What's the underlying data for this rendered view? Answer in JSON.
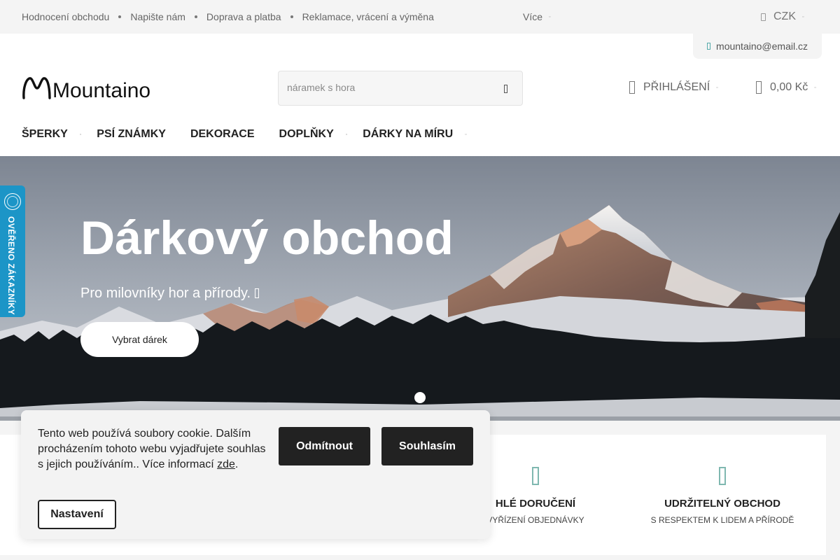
{
  "topbar": {
    "links": [
      "Hodnocení obchodu",
      "Napište nám",
      "Doprava a platba",
      "Reklamace, vrácení a výměna"
    ],
    "more_label": "Více",
    "currency": "CZK"
  },
  "contact": {
    "email": "mountaino@email.cz"
  },
  "header": {
    "logo_text": "Mountaino",
    "search_placeholder": "náramek s hora",
    "login_label": "PŘIHLÁŠENÍ",
    "cart_total": "0,00 Kč"
  },
  "menu": {
    "items": [
      {
        "label": "ŠPERKY",
        "has_submenu": true
      },
      {
        "label": "PSÍ ZNÁMKY",
        "has_submenu": false
      },
      {
        "label": "DEKORACE",
        "has_submenu": false
      },
      {
        "label": "DOPLŇKY",
        "has_submenu": true
      },
      {
        "label": "DÁRKY NA MÍRU",
        "has_submenu": true
      }
    ]
  },
  "hero": {
    "title": "Dárkový obchod",
    "subtitle": "Pro milovníky hor a přírody. ",
    "button": "Vybrat dárek",
    "slides": 1
  },
  "badge": {
    "text": "OVĚŘENO ZÁKAZNÍKY",
    "color": "#1c95c7"
  },
  "benefits": [
    {
      "title": "HLÉ DORUČENÍ",
      "subtitle": "VYŘÍZENÍ OBJEDNÁVKY"
    },
    {
      "title": "UDRŽITELNÝ OBCHOD",
      "subtitle": "S RESPEKTEM K LIDEM A PŘÍRODĚ"
    }
  ],
  "cookie": {
    "text": "Tento web používá soubory cookie. Dalším procházením tohoto webu vyjadřujete souhlas s jejich používáním.. Více informací ",
    "link_text": "zde",
    "text_end": ".",
    "decline": "Odmítnout",
    "accept": "Souhlasím",
    "settings": "Nastavení"
  }
}
